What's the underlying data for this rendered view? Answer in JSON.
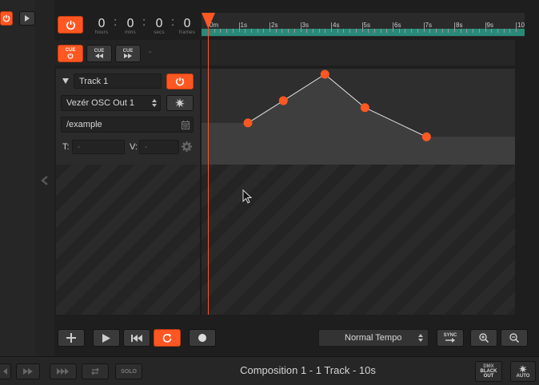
{
  "transport": {
    "hours": "0",
    "mins": "0",
    "secs": "0",
    "frames": "0",
    "hours_label": "hours",
    "mins_label": "mins",
    "secs_label": "secs",
    "frames_label": "frames"
  },
  "ruler": {
    "labels": [
      "0m",
      "1s",
      "2s",
      "3s",
      "4s",
      "5s",
      "6s",
      "7s",
      "8s",
      "9s",
      "10"
    ]
  },
  "cue": {
    "cue_label": "CUE",
    "dash": "-"
  },
  "track": {
    "name": "Track 1",
    "output": "Vezér OSC Out 1",
    "address": "/example",
    "t_label": "T:",
    "t_value": "-",
    "v_label": "V:",
    "v_value": "-"
  },
  "keyframes": {
    "points": [
      {
        "t": 1.3,
        "v": 0.3
      },
      {
        "t": 2.45,
        "v": 0.62
      },
      {
        "t": 3.8,
        "v": 1.0
      },
      {
        "t": 5.1,
        "v": 0.52
      },
      {
        "t": 7.1,
        "v": 0.1
      }
    ]
  },
  "toolbar": {
    "tempo": "Normal Tempo",
    "sync_label": "SYNC"
  },
  "status": {
    "title": "Composition 1 - 1 Track - 10s",
    "solo_label": "SOLO",
    "dmx_line1": "DMX",
    "dmx_line2": "BLACK",
    "dmx_line3": "OUT",
    "auto_label": "AUTO"
  },
  "colors": {
    "accent": "#ff5722",
    "ruler_strip": "#2a8a7a"
  }
}
